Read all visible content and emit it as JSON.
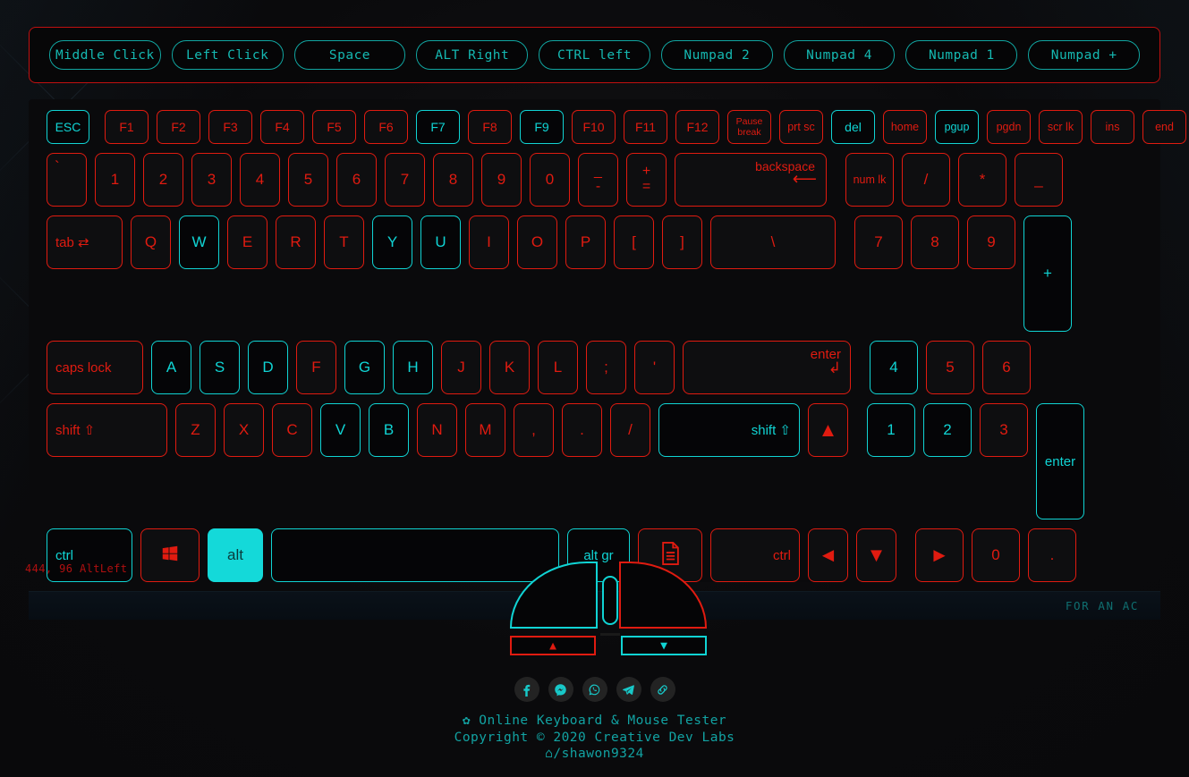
{
  "history": {
    "items": [
      {
        "label": "Middle Click"
      },
      {
        "label": "Left Click"
      },
      {
        "label": "Space"
      },
      {
        "label": "ALT Right"
      },
      {
        "label": "CTRL left"
      },
      {
        "label": "Numpad 2"
      },
      {
        "label": "Numpad 4"
      },
      {
        "label": "Numpad 1"
      },
      {
        "label": "Numpad +"
      }
    ]
  },
  "colors": {
    "idle": "#e01b10",
    "active": "#10d4d4",
    "held_fill": "#14d9d9",
    "background": "#0b0b0d"
  },
  "keyboard": {
    "fn_row": [
      {
        "label": "ESC",
        "state": "on"
      },
      {
        "label": "F1",
        "state": "off"
      },
      {
        "label": "F2",
        "state": "off"
      },
      {
        "label": "F3",
        "state": "off"
      },
      {
        "label": "F4",
        "state": "off"
      },
      {
        "label": "F5",
        "state": "off"
      },
      {
        "label": "F6",
        "state": "off"
      },
      {
        "label": "F7",
        "state": "on"
      },
      {
        "label": "F8",
        "state": "off"
      },
      {
        "label": "F9",
        "state": "on"
      },
      {
        "label": "F10",
        "state": "off"
      },
      {
        "label": "F11",
        "state": "off"
      },
      {
        "label": "F12",
        "state": "off"
      },
      {
        "label": "Pause break",
        "state": "off"
      },
      {
        "label": "prt sc",
        "state": "off"
      },
      {
        "label": "del",
        "state": "on"
      },
      {
        "label": "home",
        "state": "off"
      },
      {
        "label": "pgup",
        "state": "on"
      },
      {
        "label": "pgdn",
        "state": "off"
      },
      {
        "label": "scr lk",
        "state": "off"
      },
      {
        "label": "ins",
        "state": "off"
      },
      {
        "label": "end",
        "state": "off"
      }
    ],
    "row_num": [
      {
        "label": "`",
        "state": "off"
      },
      {
        "label": "1",
        "state": "off"
      },
      {
        "label": "2",
        "state": "off"
      },
      {
        "label": "3",
        "state": "off"
      },
      {
        "label": "4",
        "state": "off"
      },
      {
        "label": "5",
        "state": "off"
      },
      {
        "label": "6",
        "state": "off"
      },
      {
        "label": "7",
        "state": "off"
      },
      {
        "label": "8",
        "state": "off"
      },
      {
        "label": "9",
        "state": "off"
      },
      {
        "label": "0",
        "state": "off"
      },
      {
        "label": "_ -",
        "state": "off"
      },
      {
        "label": "+ =",
        "state": "off"
      },
      {
        "label": "backspace",
        "state": "off"
      }
    ],
    "row_num_pad": [
      {
        "label": "num lk",
        "state": "off"
      },
      {
        "label": "/",
        "state": "off"
      },
      {
        "label": "*",
        "state": "off"
      },
      {
        "label": "_",
        "state": "off"
      }
    ],
    "row_qwerty": [
      {
        "label": "tab ⇄",
        "state": "off"
      },
      {
        "label": "Q",
        "state": "off"
      },
      {
        "label": "W",
        "state": "on"
      },
      {
        "label": "E",
        "state": "off"
      },
      {
        "label": "R",
        "state": "off"
      },
      {
        "label": "T",
        "state": "off"
      },
      {
        "label": "Y",
        "state": "on"
      },
      {
        "label": "U",
        "state": "on"
      },
      {
        "label": "I",
        "state": "off"
      },
      {
        "label": "O",
        "state": "off"
      },
      {
        "label": "P",
        "state": "off"
      },
      {
        "label": "[",
        "state": "off"
      },
      {
        "label": "]",
        "state": "off"
      },
      {
        "label": "\\",
        "state": "off"
      }
    ],
    "row_qwerty_pad": [
      {
        "label": "7",
        "state": "off"
      },
      {
        "label": "8",
        "state": "off"
      },
      {
        "label": "9",
        "state": "off"
      },
      {
        "label": "+",
        "state": "on"
      }
    ],
    "row_home": [
      {
        "label": "caps lock",
        "state": "off"
      },
      {
        "label": "A",
        "state": "on"
      },
      {
        "label": "S",
        "state": "on"
      },
      {
        "label": "D",
        "state": "on"
      },
      {
        "label": "F",
        "state": "off"
      },
      {
        "label": "G",
        "state": "on"
      },
      {
        "label": "H",
        "state": "on"
      },
      {
        "label": "J",
        "state": "off"
      },
      {
        "label": "K",
        "state": "off"
      },
      {
        "label": "L",
        "state": "off"
      },
      {
        "label": ";",
        "state": "off"
      },
      {
        "label": "'",
        "state": "off"
      },
      {
        "label": "enter",
        "state": "off"
      }
    ],
    "row_home_pad": [
      {
        "label": "4",
        "state": "on"
      },
      {
        "label": "5",
        "state": "off"
      },
      {
        "label": "6",
        "state": "off"
      }
    ],
    "row_shift": [
      {
        "label": "shift ⇧",
        "state": "off"
      },
      {
        "label": "Z",
        "state": "off"
      },
      {
        "label": "X",
        "state": "off"
      },
      {
        "label": "C",
        "state": "off"
      },
      {
        "label": "V",
        "state": "on"
      },
      {
        "label": "B",
        "state": "on"
      },
      {
        "label": "N",
        "state": "off"
      },
      {
        "label": "M",
        "state": "off"
      },
      {
        "label": ",",
        "state": "off"
      },
      {
        "label": ".",
        "state": "off"
      },
      {
        "label": "/",
        "state": "off"
      },
      {
        "label": "shift ⇧",
        "state": "on"
      },
      {
        "label": "▲",
        "state": "off"
      }
    ],
    "row_shift_pad": [
      {
        "label": "1",
        "state": "on"
      },
      {
        "label": "2",
        "state": "on"
      },
      {
        "label": "3",
        "state": "off"
      },
      {
        "label": "enter",
        "state": "on"
      }
    ],
    "row_bottom": [
      {
        "label": "ctrl",
        "state": "on"
      },
      {
        "label": "⊞",
        "state": "off"
      },
      {
        "label": "alt",
        "state": "held"
      },
      {
        "label": "",
        "state": "on"
      },
      {
        "label": "alt gr",
        "state": "on"
      },
      {
        "label": "▤",
        "state": "off"
      },
      {
        "label": "ctrl",
        "state": "off"
      },
      {
        "label": "◄",
        "state": "off"
      },
      {
        "label": "▼",
        "state": "off"
      },
      {
        "label": "►",
        "state": "off"
      }
    ],
    "row_bottom_pad": [
      {
        "label": "0",
        "state": "off"
      },
      {
        "label": ".",
        "state": "off"
      }
    ]
  },
  "mouse": {
    "left_button": {
      "name": "left-click",
      "state": "on"
    },
    "wheel": {
      "name": "middle-click",
      "state": "on"
    },
    "right_button": {
      "name": "right-click",
      "state": "off"
    },
    "scroll_up": {
      "label": "▲",
      "state": "off"
    },
    "scroll_down": {
      "label": "▼",
      "state": "on"
    }
  },
  "status": {
    "text": "444, 96 AltLeft"
  },
  "bottom_strip": {
    "text": "FOR AN AC"
  },
  "footer": {
    "social": [
      {
        "name": "facebook-icon",
        "glyph": "f"
      },
      {
        "name": "messenger-icon",
        "glyph": "◉"
      },
      {
        "name": "whatsapp-icon",
        "glyph": "✆"
      },
      {
        "name": "telegram-icon",
        "glyph": "➤"
      },
      {
        "name": "link-icon",
        "glyph": "∞"
      }
    ],
    "title": "✿ Online Keyboard & Mouse Tester",
    "copyright": "Copyright © 2020 Creative Dev Labs",
    "github": "⌂/shawon9324"
  }
}
